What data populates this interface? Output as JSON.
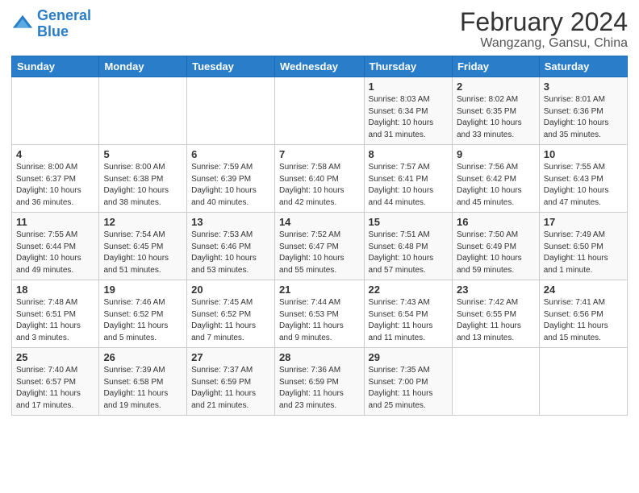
{
  "logo": {
    "line1": "General",
    "line2": "Blue"
  },
  "title": "February 2024",
  "subtitle": "Wangzang, Gansu, China",
  "header": {
    "days": [
      "Sunday",
      "Monday",
      "Tuesday",
      "Wednesday",
      "Thursday",
      "Friday",
      "Saturday"
    ]
  },
  "weeks": [
    [
      {
        "num": "",
        "detail": ""
      },
      {
        "num": "",
        "detail": ""
      },
      {
        "num": "",
        "detail": ""
      },
      {
        "num": "",
        "detail": ""
      },
      {
        "num": "1",
        "detail": "Sunrise: 8:03 AM\nSunset: 6:34 PM\nDaylight: 10 hours\nand 31 minutes."
      },
      {
        "num": "2",
        "detail": "Sunrise: 8:02 AM\nSunset: 6:35 PM\nDaylight: 10 hours\nand 33 minutes."
      },
      {
        "num": "3",
        "detail": "Sunrise: 8:01 AM\nSunset: 6:36 PM\nDaylight: 10 hours\nand 35 minutes."
      }
    ],
    [
      {
        "num": "4",
        "detail": "Sunrise: 8:00 AM\nSunset: 6:37 PM\nDaylight: 10 hours\nand 36 minutes."
      },
      {
        "num": "5",
        "detail": "Sunrise: 8:00 AM\nSunset: 6:38 PM\nDaylight: 10 hours\nand 38 minutes."
      },
      {
        "num": "6",
        "detail": "Sunrise: 7:59 AM\nSunset: 6:39 PM\nDaylight: 10 hours\nand 40 minutes."
      },
      {
        "num": "7",
        "detail": "Sunrise: 7:58 AM\nSunset: 6:40 PM\nDaylight: 10 hours\nand 42 minutes."
      },
      {
        "num": "8",
        "detail": "Sunrise: 7:57 AM\nSunset: 6:41 PM\nDaylight: 10 hours\nand 44 minutes."
      },
      {
        "num": "9",
        "detail": "Sunrise: 7:56 AM\nSunset: 6:42 PM\nDaylight: 10 hours\nand 45 minutes."
      },
      {
        "num": "10",
        "detail": "Sunrise: 7:55 AM\nSunset: 6:43 PM\nDaylight: 10 hours\nand 47 minutes."
      }
    ],
    [
      {
        "num": "11",
        "detail": "Sunrise: 7:55 AM\nSunset: 6:44 PM\nDaylight: 10 hours\nand 49 minutes."
      },
      {
        "num": "12",
        "detail": "Sunrise: 7:54 AM\nSunset: 6:45 PM\nDaylight: 10 hours\nand 51 minutes."
      },
      {
        "num": "13",
        "detail": "Sunrise: 7:53 AM\nSunset: 6:46 PM\nDaylight: 10 hours\nand 53 minutes."
      },
      {
        "num": "14",
        "detail": "Sunrise: 7:52 AM\nSunset: 6:47 PM\nDaylight: 10 hours\nand 55 minutes."
      },
      {
        "num": "15",
        "detail": "Sunrise: 7:51 AM\nSunset: 6:48 PM\nDaylight: 10 hours\nand 57 minutes."
      },
      {
        "num": "16",
        "detail": "Sunrise: 7:50 AM\nSunset: 6:49 PM\nDaylight: 10 hours\nand 59 minutes."
      },
      {
        "num": "17",
        "detail": "Sunrise: 7:49 AM\nSunset: 6:50 PM\nDaylight: 11 hours\nand 1 minute."
      }
    ],
    [
      {
        "num": "18",
        "detail": "Sunrise: 7:48 AM\nSunset: 6:51 PM\nDaylight: 11 hours\nand 3 minutes."
      },
      {
        "num": "19",
        "detail": "Sunrise: 7:46 AM\nSunset: 6:52 PM\nDaylight: 11 hours\nand 5 minutes."
      },
      {
        "num": "20",
        "detail": "Sunrise: 7:45 AM\nSunset: 6:52 PM\nDaylight: 11 hours\nand 7 minutes."
      },
      {
        "num": "21",
        "detail": "Sunrise: 7:44 AM\nSunset: 6:53 PM\nDaylight: 11 hours\nand 9 minutes."
      },
      {
        "num": "22",
        "detail": "Sunrise: 7:43 AM\nSunset: 6:54 PM\nDaylight: 11 hours\nand 11 minutes."
      },
      {
        "num": "23",
        "detail": "Sunrise: 7:42 AM\nSunset: 6:55 PM\nDaylight: 11 hours\nand 13 minutes."
      },
      {
        "num": "24",
        "detail": "Sunrise: 7:41 AM\nSunset: 6:56 PM\nDaylight: 11 hours\nand 15 minutes."
      }
    ],
    [
      {
        "num": "25",
        "detail": "Sunrise: 7:40 AM\nSunset: 6:57 PM\nDaylight: 11 hours\nand 17 minutes."
      },
      {
        "num": "26",
        "detail": "Sunrise: 7:39 AM\nSunset: 6:58 PM\nDaylight: 11 hours\nand 19 minutes."
      },
      {
        "num": "27",
        "detail": "Sunrise: 7:37 AM\nSunset: 6:59 PM\nDaylight: 11 hours\nand 21 minutes."
      },
      {
        "num": "28",
        "detail": "Sunrise: 7:36 AM\nSunset: 6:59 PM\nDaylight: 11 hours\nand 23 minutes."
      },
      {
        "num": "29",
        "detail": "Sunrise: 7:35 AM\nSunset: 7:00 PM\nDaylight: 11 hours\nand 25 minutes."
      },
      {
        "num": "",
        "detail": ""
      },
      {
        "num": "",
        "detail": ""
      }
    ]
  ]
}
